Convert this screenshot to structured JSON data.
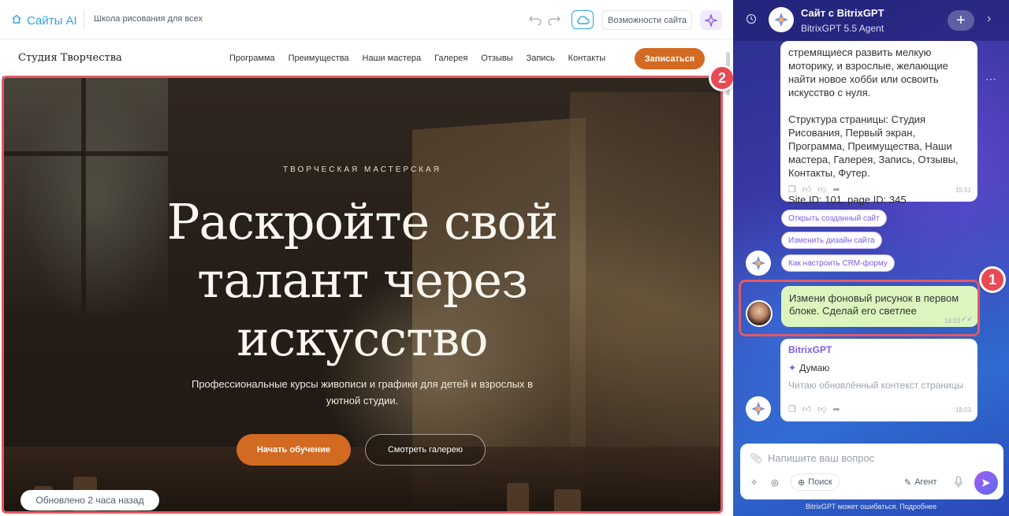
{
  "editor": {
    "brand": "Сайты AI",
    "breadcrumb": "Школа рисования для всех",
    "capabilities_label": "Возможности сайта"
  },
  "site": {
    "logo": "Студия Творчества",
    "nav": [
      "Программа",
      "Преимущества",
      "Наши мастера",
      "Галерея",
      "Отзывы",
      "Запись",
      "Контакты"
    ],
    "enroll_label": "Записаться",
    "hero": {
      "kicker": "ТВОРЧЕСКАЯ МАСТЕРСКАЯ",
      "title_lines": [
        "Раскройте свой",
        "талант через",
        "искусство"
      ],
      "subtitle": "Профессиональные курсы живописи и графики для детей и взрослых в уютной студии.",
      "primary_cta": "Начать обучение",
      "secondary_cta": "Смотреть галерею"
    },
    "updated_label": "Обновлено 2 часа назад"
  },
  "annotations": {
    "badge_1": "1",
    "badge_2": "2"
  },
  "chat": {
    "title": "Сайт с BitrixGPT",
    "subtitle": "BitrixGPT 5.5 Agent",
    "prev_message": {
      "lines": [
        "стремящиеся развить мелкую",
        "моторику, и взрослые, желающие",
        "найти новое хобби или освоить",
        "искусство с нуля."
      ],
      "structure": "Структура страницы: Студия Рисования, Первый экран, Программа, Преимущества, Наши мастера, Галерея, Запись, Отзывы, Контакты, Футер.",
      "ids": "Site ID: 101, page ID: 345",
      "time": "15:51"
    },
    "chips": [
      "Открыть созданный сайт",
      "Изменить дизайн сайта",
      "Как настроить CRM-форму"
    ],
    "user_message": {
      "text": "Измени фоновый рисунок в первом блоке. Сделай его светлее",
      "time": "18:03"
    },
    "bot_reply": {
      "author": "BitrixGPT",
      "status": "Думаю",
      "detail": "Читаю обновлённый контекст страницы",
      "time": "18:03"
    },
    "input_placeholder": "Напишите ваш вопрос",
    "tools": {
      "search": "Поиск",
      "agent": "Агент"
    },
    "disclaimer": "BitrixGPT может ошибаться. Подробнее",
    "colors": {
      "accent": "#d36a21",
      "annotation": "#e84a55",
      "user_bubble": "#dcf5bf",
      "chip_text": "#7b5cf0"
    }
  }
}
